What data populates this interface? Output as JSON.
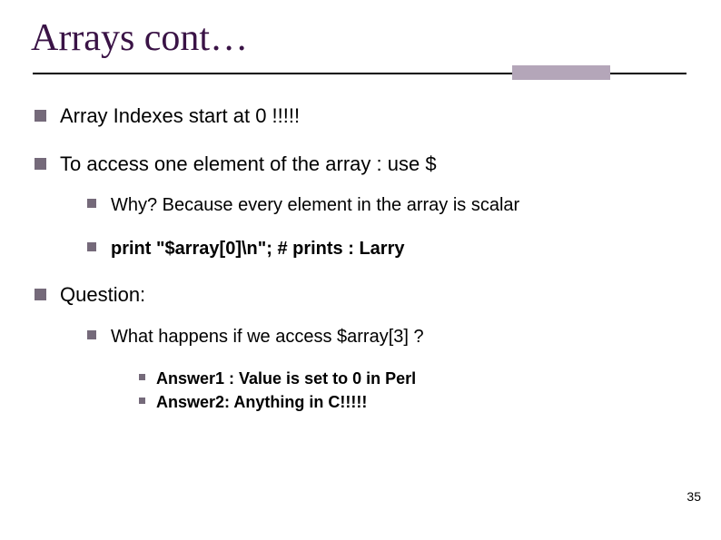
{
  "title": "Arrays cont…",
  "bullets": {
    "b1": "Array Indexes start at 0 !!!!!",
    "b2": "To access one element of the array : use $",
    "b2_sub1": "Why? Because every element in the array is scalar",
    "b2_sub2": "print \"$array[0]\\n\";  #  prints : Larry",
    "b3": "Question:",
    "b3_sub1": "What happens if we access $array[3] ?",
    "b3_sub1_a1": "Answer1 : Value is set to 0 in Perl",
    "b3_sub1_a2": "Answer2:  Anything in C!!!!!"
  },
  "slide_number": "35"
}
